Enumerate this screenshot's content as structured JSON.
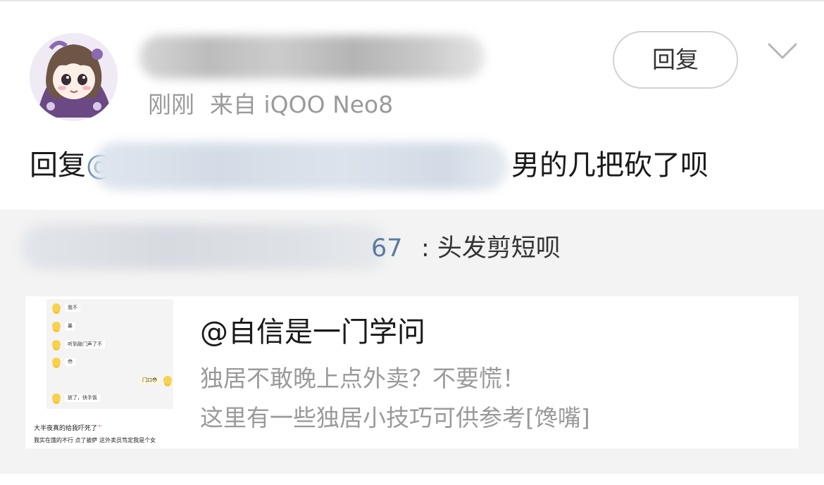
{
  "comment": {
    "author_name": "",
    "timestamp": "刚刚",
    "source": "来自 iQOO Neo8",
    "reply_button_label": "回复",
    "menu_icon": "chevron-down-icon",
    "reply_prefix": "回复",
    "mention_at": "@",
    "reply_text": "男的几把砍了呗"
  },
  "quoted": {
    "user_tail": "67",
    "text": ": 头发剪短呗"
  },
  "card": {
    "title": "@自信是一门学问",
    "description_line1": "独居不敢晚上点外卖？不要慌！",
    "description_line2": "这里有一些独居小技巧可供参考[馋嘴]",
    "thumbnail": {
      "chat_lines": [
        "我不",
        "暴",
        "听到敲门声了不",
        "😳",
        "放了，快手饭"
      ],
      "chat_right": "门口😳",
      "caption_line1": "大半夜真的给我吓死了",
      "caption_line2": "我实在饿的不行 点了披萨 这外卖员笃定我是个女"
    }
  },
  "colors": {
    "link": "#5a7c9e",
    "meta_gray": "#9a9a9a",
    "quote_bg": "#f3f3f3"
  }
}
